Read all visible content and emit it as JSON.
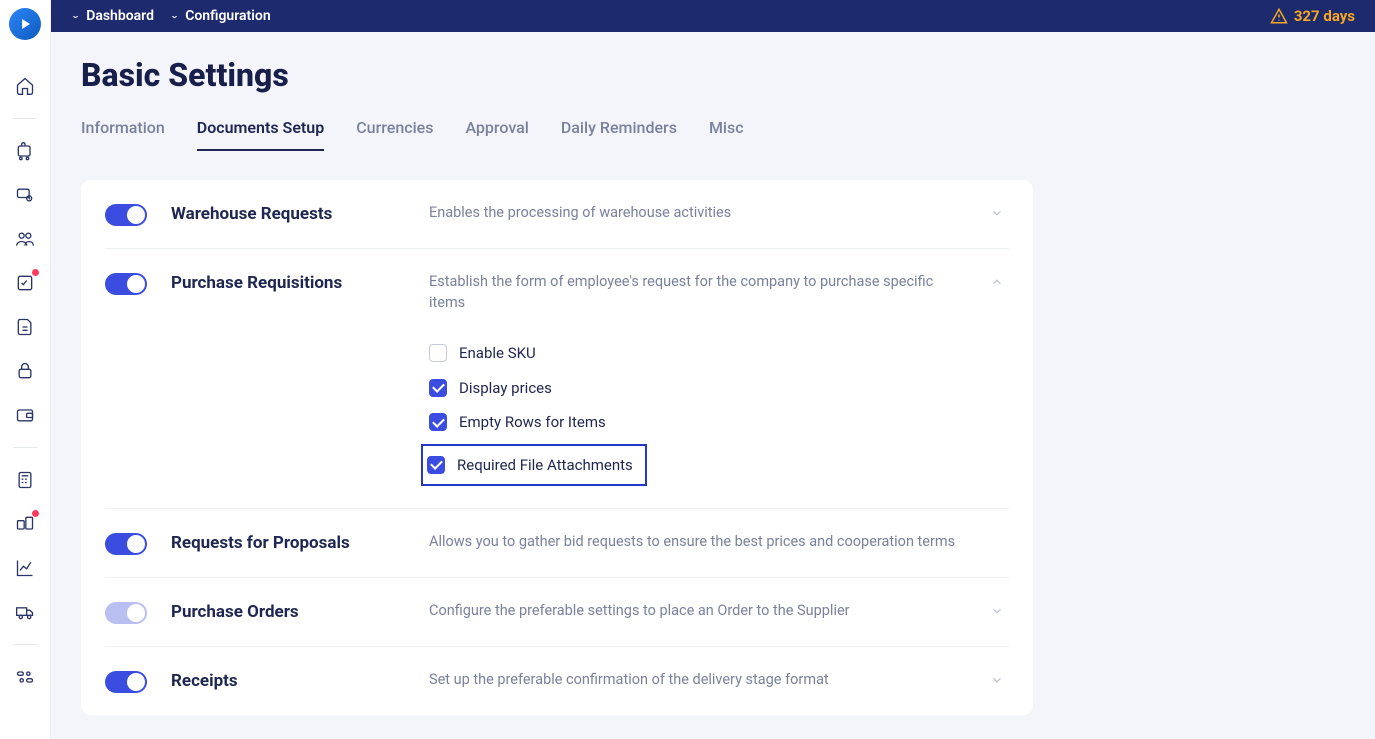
{
  "breadcrumbs": {
    "item1": "Dashboard",
    "item2": "Configuration"
  },
  "warning_days": "327 days",
  "page_title": "Basic Settings",
  "tabs": {
    "information": "Information",
    "documents_setup": "Documents Setup",
    "currencies": "Currencies",
    "approval": "Approval",
    "daily_reminders": "Daily Reminders",
    "misc": "Misc"
  },
  "sections": {
    "warehouse_requests": {
      "name": "Warehouse Requests",
      "desc": "Enables the processing of warehouse activities"
    },
    "purchase_requisitions": {
      "name": "Purchase Requisitions",
      "desc": "Establish the form of employee's request for the company to purchase specific items",
      "options": {
        "enable_sku": "Enable SKU",
        "display_prices": "Display prices",
        "empty_rows": "Empty Rows for Items",
        "required_attach": "Required File Attachments"
      }
    },
    "rfp": {
      "name": "Requests for Proposals",
      "desc": "Allows you to gather bid requests to ensure the best prices and cooperation terms"
    },
    "purchase_orders": {
      "name": "Purchase Orders",
      "desc": "Configure the preferable settings to place an Order to the Supplier"
    },
    "receipts": {
      "name": "Receipts",
      "desc": "Set up the preferable confirmation of the delivery stage format"
    }
  }
}
